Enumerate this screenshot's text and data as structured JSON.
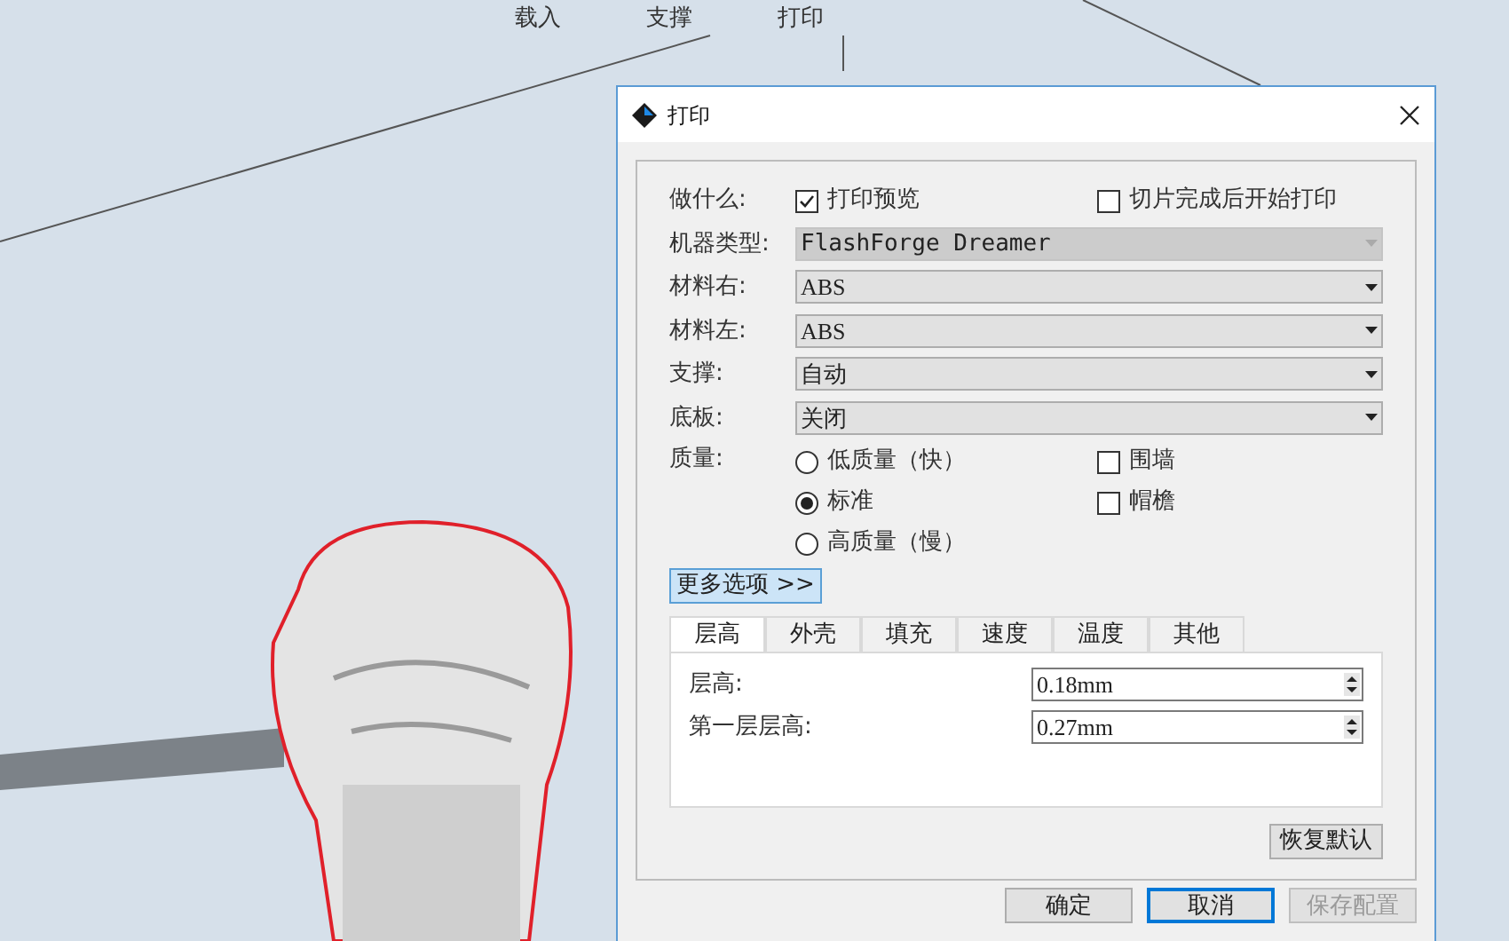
{
  "menu": [
    {
      "label": "载入"
    },
    {
      "label": "支撑"
    },
    {
      "label": "打印"
    }
  ],
  "dialog": {
    "title": "打印",
    "task": {
      "label": "做什么:",
      "options": [
        {
          "label": "打印预览",
          "checked": true
        },
        {
          "label": "切片完成后开始打印",
          "checked": false
        }
      ]
    },
    "selects": [
      {
        "label": "机器类型:",
        "value": "FlashForge Dreamer",
        "disabled": true
      },
      {
        "label": "材料右:",
        "value": "ABS",
        "disabled": false
      },
      {
        "label": "材料左:",
        "value": "ABS",
        "disabled": false
      },
      {
        "label": "支撑:",
        "value": "自动",
        "disabled": false
      },
      {
        "label": "底板:",
        "value": "关闭",
        "disabled": false
      }
    ],
    "quality": {
      "label": "质量:",
      "options": [
        {
          "label": "低质量（快）",
          "selected": false
        },
        {
          "label": "标准",
          "selected": true
        },
        {
          "label": "高质量（慢）",
          "selected": false
        }
      ],
      "extras": [
        {
          "label": "围墙",
          "checked": false
        },
        {
          "label": "帽檐",
          "checked": false
        }
      ]
    },
    "more_options": "更多选项 >>",
    "tabs": [
      {
        "label": "层高",
        "selected": true
      },
      {
        "label": "外壳",
        "selected": false
      },
      {
        "label": "填充",
        "selected": false
      },
      {
        "label": "速度",
        "selected": false
      },
      {
        "label": "温度",
        "selected": false
      },
      {
        "label": "其他",
        "selected": false
      }
    ],
    "tab_fields": [
      {
        "label": "层高:",
        "value": "0.18mm"
      },
      {
        "label": "第一层层高:",
        "value": "0.27mm"
      }
    ],
    "restore": "恢复默认",
    "buttons": [
      {
        "label": "确定",
        "kind": "normal"
      },
      {
        "label": "取消",
        "kind": "focused"
      },
      {
        "label": "保存配置",
        "kind": "disabled"
      }
    ]
  }
}
